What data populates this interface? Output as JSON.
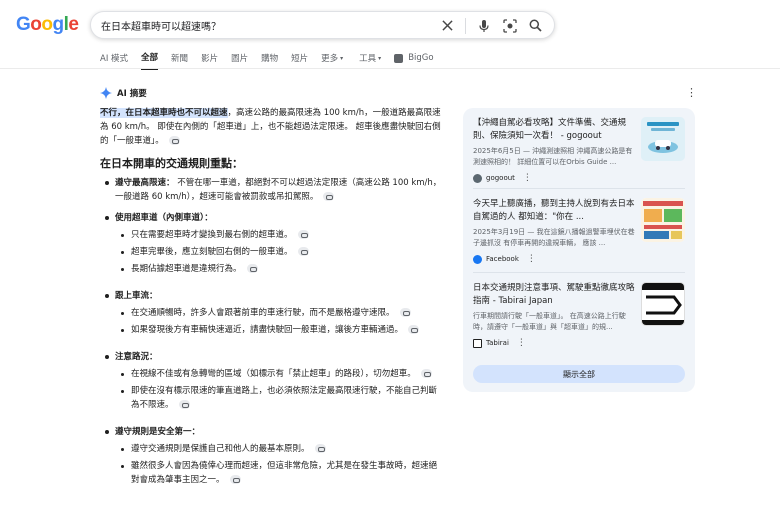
{
  "header": {
    "logo_letters": [
      "G",
      "o",
      "o",
      "g",
      "l",
      "e"
    ],
    "search_query": "在日本超車時可以超速嗎？"
  },
  "tabs": [
    {
      "label": "AI 模式",
      "active": false
    },
    {
      "label": "全部",
      "active": true
    },
    {
      "label": "新聞",
      "active": false
    },
    {
      "label": "影片",
      "active": false
    },
    {
      "label": "圖片",
      "active": false
    },
    {
      "label": "購物",
      "active": false
    },
    {
      "label": "短片",
      "active": false
    },
    {
      "label": "更多",
      "active": false,
      "caret": "▾"
    },
    {
      "label": "工具",
      "active": false,
      "caret": "▾"
    },
    {
      "label": "BigGo",
      "active": false
    }
  ],
  "ai_overview": {
    "label": "AI 摘要",
    "answer_highlight": "不行，在日本超車時也不可以超速",
    "answer_rest": "，高速公路的最高限速為 100 km/h，一般道路最高限速為 60 km/h。 即使在內側的「超車道」上，也不能超過法定限速。 超車後應盡快駛回右側的「一般車道」。",
    "section_title": "在日本開車的交通規則重點：",
    "items": [
      {
        "title": "遵守最高限速：",
        "text": " 不管在哪一車道，都絕對不可以超過法定限速（高速公路 100 km/h，一般道路 60 km/h），超速可能會被罰款或吊扣駕照。",
        "subs": []
      },
      {
        "title": "使用超車道（內側車道）：",
        "text": "",
        "subs": [
          "只在需要超車時才變換到最右側的超車道。",
          "超車完畢後，應立刻駛回右側的一般車道。",
          "長期佔據超車道是違規行為。"
        ]
      },
      {
        "title": "跟上車流：",
        "text": "",
        "subs": [
          "在交通順暢時，許多人會跟著前車的車速行駛，而不是嚴格遵守速限。",
          "如果發現後方有車輛快速逼近，請盡快駛回一般車道，讓後方車輛通過。"
        ]
      },
      {
        "title": "注意路況：",
        "text": "",
        "subs": [
          "在視線不佳或有急轉彎的區域（如標示有「禁止超車」的路段），切勿超車。",
          "即使在沒有標示限速的筆直道路上，也必須依照法定最高限速行駛，不能自己判斷為不限速。"
        ]
      },
      {
        "title": "遵守規則是安全第一：",
        "text": "",
        "subs": [
          "遵守交通規則是保護自己和他人的最基本原則。",
          "雖然很多人會因為僥倖心理而超速，但這非常危險，尤其是在發生事故時，超速絕對會成為肇事主因之一。"
        ]
      }
    ]
  },
  "sources": [
    {
      "title": "【沖繩自駕必看攻略】文件準備、交通規則、保險須知一次看！ - gogoout",
      "snippet": "2025年6月5日 — 沖繩測速照相 沖繩高速公路是有測速照相的！ 詳細位置可以在Orbis Guide ...",
      "site": "gogoout",
      "fav_color": "#5b6770"
    },
    {
      "title": "今天早上聽廣播，聽到主持人說到有去日本自駕過的人 都知道：\"你在 ...",
      "snippet": "2025年3月19日 — 我在這鏡八播報過警車埋伏在巷子邊抓沒 有停車再開的違規車輛， 應該 ...",
      "site": "Facebook",
      "fav_color": "#1877f2"
    },
    {
      "title": "日本交通規則注意事項、駕駛重點徹底攻略指南 - Tabirai Japan",
      "snippet": "行車期間請行駛「一般車道」。 在高速公路上行駛時，請遵守「一般車道」與「超車道」的規...",
      "site": "Tabirai",
      "fav_color": "#1f1f1f"
    }
  ],
  "show_all_label": "顯示全部",
  "colors": {
    "logo": [
      "#4285f4",
      "#ea4335",
      "#fbbc05",
      "#4285f4",
      "#34a853",
      "#ea4335"
    ],
    "highlight": "#d3e3fd",
    "card_bg": "#f0f4f9"
  }
}
